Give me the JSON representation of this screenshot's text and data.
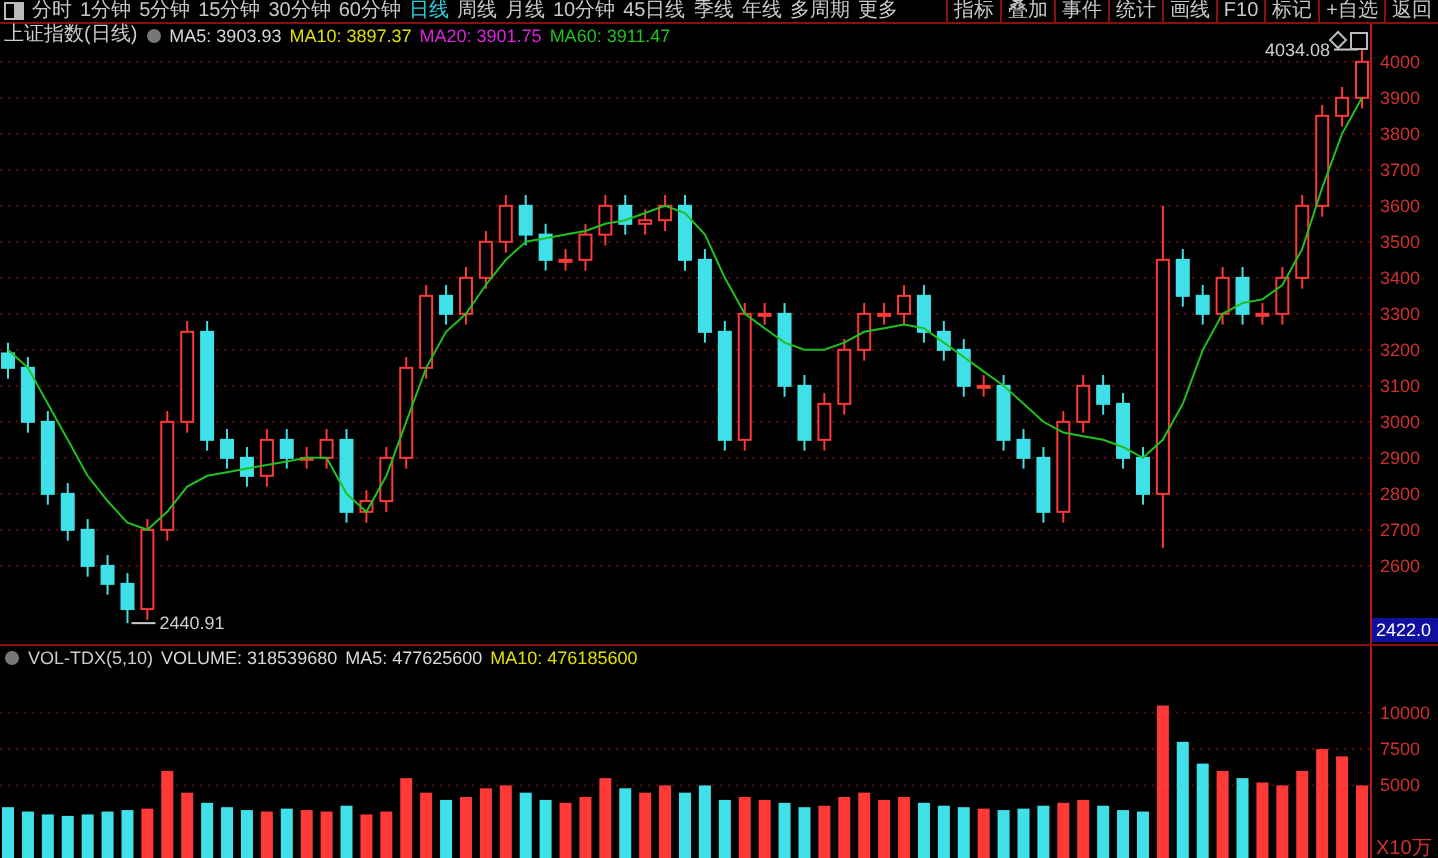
{
  "toolbar": {
    "periods": [
      {
        "label": "分时",
        "selected": false
      },
      {
        "label": "1分钟",
        "selected": false
      },
      {
        "label": "5分钟",
        "selected": false
      },
      {
        "label": "15分钟",
        "selected": false
      },
      {
        "label": "30分钟",
        "selected": false
      },
      {
        "label": "60分钟",
        "selected": false
      },
      {
        "label": "日线",
        "selected": true
      },
      {
        "label": "周线",
        "selected": false
      },
      {
        "label": "月线",
        "selected": false
      },
      {
        "label": "10分钟",
        "selected": false
      },
      {
        "label": "45日线",
        "selected": false
      },
      {
        "label": "季线",
        "selected": false
      },
      {
        "label": "年线",
        "selected": false
      },
      {
        "label": "多周期",
        "selected": false
      },
      {
        "label": "更多",
        "selected": false
      }
    ],
    "tools": [
      "指标",
      "叠加",
      "事件",
      "统计",
      "画线",
      "F10",
      "标记",
      "+自选",
      "返回"
    ]
  },
  "price_panel": {
    "title": "上证指数(日线)",
    "indicators": [
      {
        "text": "MA5: 3903.93",
        "color": "#d8d8d8"
      },
      {
        "text": "MA10: 3897.37",
        "color": "#e0e000"
      },
      {
        "text": "MA20: 3901.75",
        "color": "#e020e0"
      },
      {
        "text": "MA60: 3911.47",
        "color": "#20c020"
      }
    ],
    "price_tag": "2422.0",
    "chart_data": {
      "type": "candlestick",
      "grid": true,
      "ylim": [
        2383,
        4105
      ],
      "yticks": [
        2600,
        2700,
        2800,
        2900,
        3000,
        3100,
        3200,
        3300,
        3400,
        3500,
        3600,
        3700,
        3800,
        3900,
        4000
      ],
      "ohlc": [
        [
          3190,
          3220,
          3120,
          3150
        ],
        [
          3150,
          3180,
          2970,
          3000
        ],
        [
          3000,
          3030,
          2770,
          2800
        ],
        [
          2800,
          2830,
          2670,
          2700
        ],
        [
          2700,
          2730,
          2570,
          2600
        ],
        [
          2600,
          2630,
          2520,
          2550
        ],
        [
          2550,
          2580,
          2440.91,
          2480
        ],
        [
          2480,
          2730,
          2450,
          2700
        ],
        [
          2700,
          3030,
          2670,
          3000
        ],
        [
          3000,
          3280,
          2970,
          3250
        ],
        [
          3250,
          3280,
          2920,
          2950
        ],
        [
          2950,
          2980,
          2870,
          2900
        ],
        [
          2900,
          2930,
          2820,
          2850
        ],
        [
          2850,
          2980,
          2820,
          2950
        ],
        [
          2950,
          2980,
          2870,
          2900
        ],
        [
          2900,
          2930,
          2870,
          2900
        ],
        [
          2900,
          2980,
          2870,
          2950
        ],
        [
          2950,
          2980,
          2720,
          2750
        ],
        [
          2750,
          2810,
          2720,
          2780
        ],
        [
          2780,
          2930,
          2750,
          2900
        ],
        [
          2900,
          3180,
          2870,
          3150
        ],
        [
          3150,
          3380,
          3120,
          3350
        ],
        [
          3350,
          3380,
          3270,
          3300
        ],
        [
          3300,
          3430,
          3270,
          3400
        ],
        [
          3400,
          3530,
          3370,
          3500
        ],
        [
          3500,
          3630,
          3470,
          3600
        ],
        [
          3600,
          3630,
          3490,
          3520
        ],
        [
          3520,
          3550,
          3420,
          3450
        ],
        [
          3450,
          3480,
          3420,
          3450
        ],
        [
          3450,
          3550,
          3420,
          3520
        ],
        [
          3520,
          3630,
          3490,
          3600
        ],
        [
          3600,
          3630,
          3520,
          3550
        ],
        [
          3550,
          3590,
          3520,
          3560
        ],
        [
          3560,
          3630,
          3530,
          3600
        ],
        [
          3600,
          3630,
          3420,
          3450
        ],
        [
          3450,
          3480,
          3220,
          3250
        ],
        [
          3250,
          3280,
          2920,
          2950
        ],
        [
          2950,
          3330,
          2920,
          3300
        ],
        [
          3300,
          3330,
          3270,
          3300
        ],
        [
          3300,
          3330,
          3070,
          3100
        ],
        [
          3100,
          3130,
          2920,
          2950
        ],
        [
          2950,
          3080,
          2920,
          3050
        ],
        [
          3050,
          3230,
          3020,
          3200
        ],
        [
          3200,
          3330,
          3170,
          3300
        ],
        [
          3300,
          3330,
          3270,
          3300
        ],
        [
          3300,
          3380,
          3270,
          3350
        ],
        [
          3350,
          3380,
          3220,
          3250
        ],
        [
          3250,
          3280,
          3170,
          3200
        ],
        [
          3200,
          3230,
          3070,
          3100
        ],
        [
          3100,
          3130,
          3070,
          3100
        ],
        [
          3100,
          3130,
          2920,
          2950
        ],
        [
          2950,
          2980,
          2870,
          2900
        ],
        [
          2900,
          2930,
          2720,
          2750
        ],
        [
          2750,
          3030,
          2720,
          3000
        ],
        [
          3000,
          3130,
          2970,
          3100
        ],
        [
          3100,
          3130,
          3020,
          3050
        ],
        [
          3050,
          3080,
          2870,
          2900
        ],
        [
          2900,
          2930,
          2770,
          2800
        ],
        [
          2800,
          3600,
          2650,
          3450
        ],
        [
          3450,
          3480,
          3320,
          3350
        ],
        [
          3350,
          3380,
          3270,
          3300
        ],
        [
          3300,
          3430,
          3270,
          3400
        ],
        [
          3400,
          3430,
          3270,
          3300
        ],
        [
          3300,
          3330,
          3270,
          3300
        ],
        [
          3300,
          3430,
          3270,
          3400
        ],
        [
          3400,
          3630,
          3370,
          3600
        ],
        [
          3600,
          3880,
          3570,
          3850
        ],
        [
          3850,
          3930,
          3820,
          3900
        ],
        [
          3900,
          4034.08,
          3870,
          4000
        ]
      ],
      "series": [
        {
          "type": "line",
          "color": "#20c020",
          "values": [
            3200,
            3150,
            3050,
            2950,
            2850,
            2780,
            2720,
            2700,
            2750,
            2820,
            2850,
            2860,
            2870,
            2880,
            2890,
            2900,
            2900,
            2800,
            2750,
            2850,
            3000,
            3150,
            3250,
            3300,
            3380,
            3450,
            3500,
            3510,
            3520,
            3530,
            3550,
            3560,
            3580,
            3600,
            3580,
            3520,
            3400,
            3300,
            3260,
            3220,
            3200,
            3200,
            3220,
            3250,
            3260,
            3270,
            3260,
            3220,
            3180,
            3140,
            3100,
            3050,
            3000,
            2970,
            2960,
            2950,
            2930,
            2900,
            2950,
            3050,
            3200,
            3300,
            3330,
            3340,
            3380,
            3480,
            3650,
            3800,
            3900
          ]
        }
      ],
      "annotations": [
        "4034.08",
        "2440.91"
      ]
    }
  },
  "volume_panel": {
    "title": "VOL-TDX(5,10)",
    "indicators": [
      {
        "text": "VOLUME: 318539680",
        "color": "#d8d8d8"
      },
      {
        "text": "MA5: 477625600",
        "color": "#d8d8d8"
      },
      {
        "text": "MA10: 476185600",
        "color": "#e0e000"
      }
    ],
    "unit": "X10万",
    "chart_data": {
      "type": "bar",
      "grid": true,
      "ylim": [
        0,
        14600
      ],
      "yticks": [
        5000,
        7500,
        10000
      ],
      "series": [
        {
          "values": [
            3500,
            3200,
            3000,
            2900,
            3000,
            3200,
            3300,
            3400,
            6000,
            4500,
            3800,
            3500,
            3300,
            3200,
            3400,
            3300,
            3200,
            3600,
            3000,
            3200,
            5500,
            4500,
            4000,
            4200,
            4800,
            5000,
            4500,
            4000,
            3800,
            4200,
            5500,
            4800,
            4500,
            5000,
            4500,
            5000,
            4000,
            4200,
            4000,
            3800,
            3500,
            3600,
            4200,
            4500,
            4000,
            4200,
            3800,
            3600,
            3500,
            3400,
            3300,
            3400,
            3600,
            3800,
            4000,
            3600,
            3300,
            3200,
            10500,
            8000,
            6500,
            6000,
            5500,
            5200,
            5000,
            6000,
            7500,
            7000,
            5000
          ]
        }
      ]
    }
  }
}
